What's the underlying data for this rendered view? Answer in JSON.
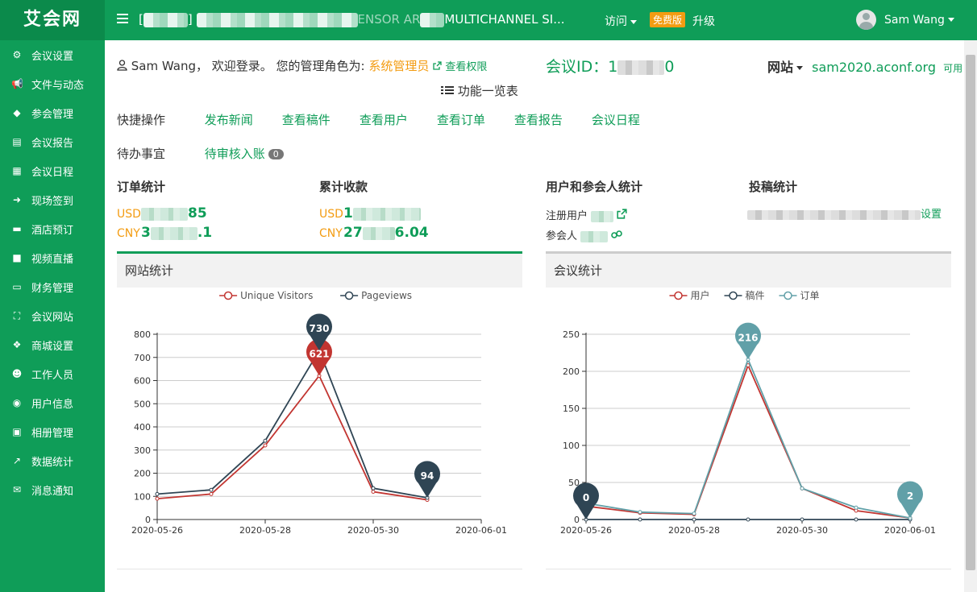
{
  "brand": "艾会网",
  "header": {
    "title_prefix": "[",
    "title_mid": "]",
    "title_fragment1": "ENSOR AR",
    "title_fragment2": "MULTICHANNEL SI...",
    "visit": "访问",
    "free_badge": "免费版",
    "upgrade": "升级",
    "user": "Sam Wang"
  },
  "sidebar": {
    "items": [
      {
        "label": "会议设置",
        "icon": "gears-icon"
      },
      {
        "label": "文件与动态",
        "icon": "bullhorn-icon"
      },
      {
        "label": "参会管理",
        "icon": "ticket-icon"
      },
      {
        "label": "会议报告",
        "icon": "file-icon"
      },
      {
        "label": "会议日程",
        "icon": "calendar-icon"
      },
      {
        "label": "现场签到",
        "icon": "signin-icon"
      },
      {
        "label": "酒店预订",
        "icon": "bed-icon"
      },
      {
        "label": "视频直播",
        "icon": "video-icon"
      },
      {
        "label": "财务管理",
        "icon": "credit-card-icon"
      },
      {
        "label": "会议网站",
        "icon": "sitemap-icon"
      },
      {
        "label": "商城设置",
        "icon": "cubes-icon"
      },
      {
        "label": "工作人员",
        "icon": "users-icon"
      },
      {
        "label": "用户信息",
        "icon": "user-circle-icon"
      },
      {
        "label": "相册管理",
        "icon": "image-icon"
      },
      {
        "label": "数据统计",
        "icon": "line-chart-icon"
      },
      {
        "label": "消息通知",
        "icon": "envelope-icon"
      }
    ]
  },
  "welcome": {
    "user": "Sam Wang，",
    "greeting": "欢迎登录。",
    "role_prefix": "您的管理角色为:",
    "role": "系统管理员",
    "perm": "查看权限",
    "func_list": "功能一览表"
  },
  "conference": {
    "id_label": "会议ID：",
    "id_prefix": "1",
    "id_suffix": "0",
    "site_label": "网站",
    "site_url": "sam2020.aconf.org",
    "site_status": "可用"
  },
  "quick": {
    "label": "快捷操作",
    "links": [
      "发布新闻",
      "查看稿件",
      "查看用户",
      "查看订单",
      "查看报告",
      "会议日程"
    ]
  },
  "todo": {
    "label": "待办事宜",
    "item": "待审核入账",
    "count": "0"
  },
  "stats": {
    "orders_title": "订单统计",
    "orders_usd_cur": "USD",
    "orders_usd_head": "",
    "orders_usd_tail": "85",
    "orders_cny_cur": "CNY",
    "orders_cny_head": "3",
    "orders_cny_tail": ".1",
    "income_title": "累计收款",
    "income_usd_cur": "USD",
    "income_usd_head": "1",
    "income_cny_cur": "CNY",
    "income_cny_head": "27",
    "income_cny_tail": "6.04",
    "users_title": "用户和参会人统计",
    "reg_label": "注册用户",
    "attendee_label": "参会人",
    "sub_title": "投稿统计",
    "sub_tail": "设置"
  },
  "panels": {
    "site_title": "网站统计",
    "conf_title": "会议统计"
  },
  "chart_data": [
    {
      "type": "line",
      "title": "网站统计",
      "x": [
        "2020-05-26",
        "2020-05-27",
        "2020-05-28",
        "2020-05-29",
        "2020-05-30",
        "2020-05-31"
      ],
      "xticks": [
        "2020-05-26",
        "2020-05-28",
        "2020-05-30",
        "2020-06-01"
      ],
      "ylim": [
        0,
        800
      ],
      "yticks": [
        0,
        100,
        200,
        300,
        400,
        500,
        600,
        700,
        800
      ],
      "series": [
        {
          "name": "Unique Visitors",
          "color": "#c23531",
          "values": [
            90,
            110,
            320,
            621,
            120,
            85
          ],
          "pins": [
            {
              "index": 3,
              "label": "621"
            }
          ]
        },
        {
          "name": "Pageviews",
          "color": "#2f4554",
          "values": [
            110,
            128,
            340,
            730,
            135,
            94
          ],
          "pins": [
            {
              "index": 3,
              "label": "730"
            },
            {
              "index": 5,
              "label": "94"
            }
          ]
        }
      ],
      "grid": true,
      "legend": "top-center"
    },
    {
      "type": "line",
      "title": "会议统计",
      "x": [
        "2020-05-26",
        "2020-05-27",
        "2020-05-28",
        "2020-05-29",
        "2020-05-30",
        "2020-05-31",
        "2020-06-01"
      ],
      "xticks": [
        "2020-05-26",
        "2020-05-28",
        "2020-05-30",
        "2020-06-01"
      ],
      "ylim": [
        0,
        250
      ],
      "yticks": [
        0,
        50,
        100,
        150,
        200,
        250
      ],
      "series": [
        {
          "name": "用户",
          "color": "#c23531",
          "values": [
            18,
            9,
            7,
            208,
            42,
            12,
            2
          ],
          "pins": []
        },
        {
          "name": "稿件",
          "color": "#2f4554",
          "values": [
            0,
            0,
            0,
            0,
            0,
            0,
            0
          ],
          "pins": [
            {
              "index": 0,
              "label": "0"
            }
          ]
        },
        {
          "name": "订单",
          "color": "#61a0a8",
          "values": [
            22,
            10,
            8,
            216,
            42,
            16,
            2
          ],
          "pins": [
            {
              "index": 3,
              "label": "216"
            },
            {
              "index": 6,
              "label": "2"
            }
          ]
        }
      ],
      "grid": true,
      "legend": "top-center"
    }
  ]
}
